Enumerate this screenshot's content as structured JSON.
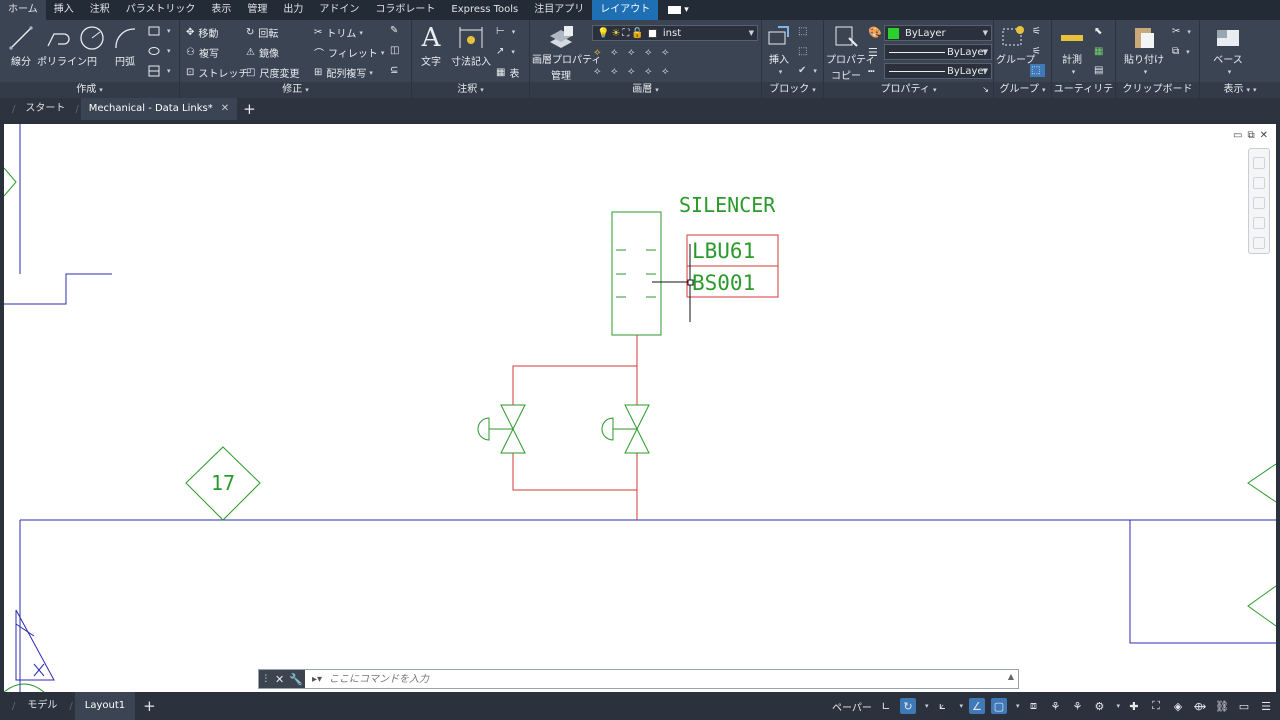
{
  "ribbon_tabs": [
    "ホーム",
    "挿入",
    "注釈",
    "パラメトリック",
    "表示",
    "管理",
    "出力",
    "アドイン",
    "コラボレート",
    "Express Tools",
    "注目アプリ",
    "レイアウト"
  ],
  "active_ribbon_tab": "レイアウト",
  "panels": {
    "draw": {
      "title": "作成",
      "line": "線分",
      "polyline": "ポリライン",
      "circle": "円",
      "arc": "円弧"
    },
    "modify": {
      "title": "修正",
      "move": "移動",
      "rotate": "回転",
      "trim": "トリム",
      "copy": "複写",
      "mirror": "鏡像",
      "fillet": "フィレット",
      "stretch": "ストレッチ",
      "scale": "尺度変更",
      "array": "配列複写"
    },
    "annotation": {
      "title": "注釈",
      "text": "文字",
      "dimension": "寸法記入",
      "table": "表"
    },
    "layers": {
      "title": "画層",
      "properties": "画層プロパティ\n管理",
      "properties_l1": "画層プロパティ",
      "properties_l2": "管理",
      "current_layer": "inst"
    },
    "block": {
      "title": "ブロック",
      "insert": "挿入"
    },
    "properties": {
      "title": "プロパティ",
      "match_l1": "プロパティ",
      "match_l2": "コピー",
      "color": "ByLayer",
      "linetype": "ByLayer",
      "lineweight": "ByLayer"
    },
    "groups": {
      "title": "グループ",
      "group": "グループ"
    },
    "utilities": {
      "title": "ユーティリティ",
      "measure": "計測"
    },
    "clipboard": {
      "title": "クリップボード",
      "paste": "貼り付け"
    },
    "view": {
      "title": "表示",
      "base": "ベース"
    }
  },
  "doc_tabs": {
    "start": "スタート",
    "active": "Mechanical - Data Links*"
  },
  "drawing": {
    "silencer": "SILENCER",
    "tag_line1": "LBU61",
    "tag_line2": "BS001",
    "marker": "17"
  },
  "command": {
    "placeholder": "ここにコマンドを入力"
  },
  "layout_tabs": [
    "モデル",
    "Layout1"
  ],
  "active_layout": "Layout1",
  "status": {
    "paper": "ペーパー"
  },
  "colors": {
    "accent": "#1f6fb5",
    "ribbon_bg": "#3b4453",
    "green": "#2a9a2a",
    "red": "#d43a3a",
    "blue": "#2b2bb3"
  }
}
